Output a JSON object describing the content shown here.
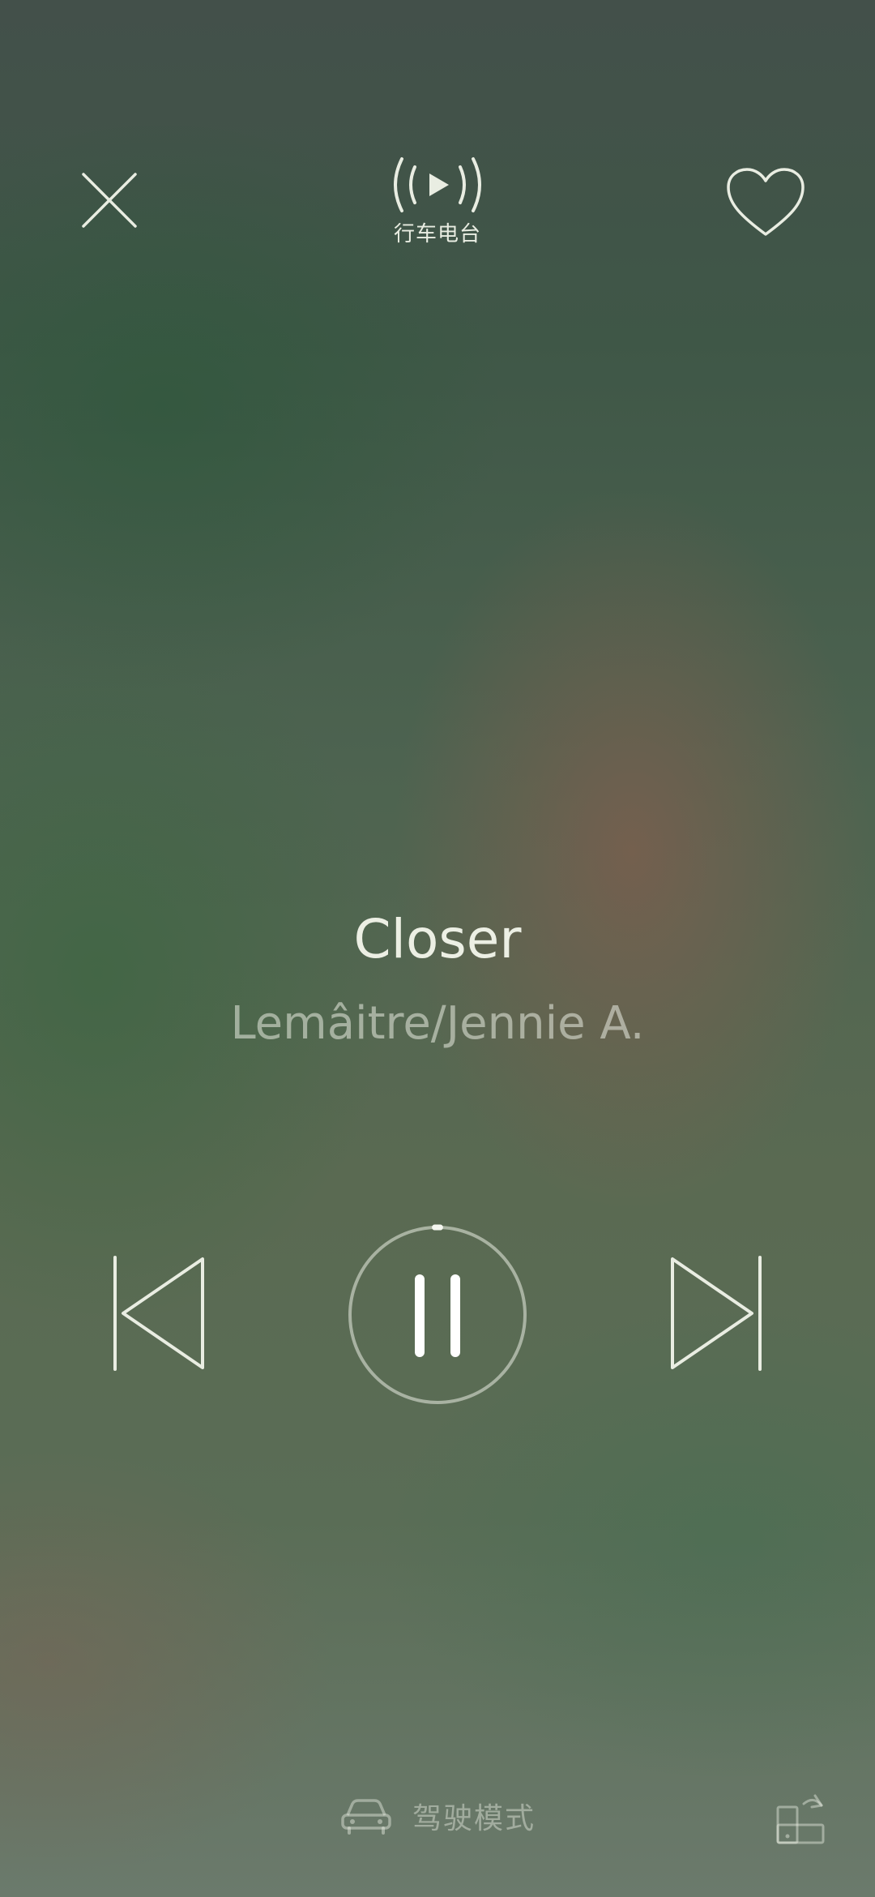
{
  "header": {
    "radio_label": "行车电台",
    "close_icon": "close-icon",
    "radio_icon": "broadcast-play-icon",
    "favorite_icon": "heart-outline-icon"
  },
  "song": {
    "title": "Closer",
    "artist": "Lemâitre/Jennie A."
  },
  "controls": {
    "previous_icon": "skip-previous-icon",
    "play_state_icon": "pause-icon",
    "next_icon": "skip-next-icon",
    "progress": 0.01
  },
  "footer": {
    "drive_mode_label": "驾驶模式",
    "drive_mode_icon": "car-icon",
    "cast_icon": "device-switch-icon"
  },
  "colors": {
    "foreground": "#e9ede2",
    "muted": "rgba(233,237,226,0.55)"
  }
}
